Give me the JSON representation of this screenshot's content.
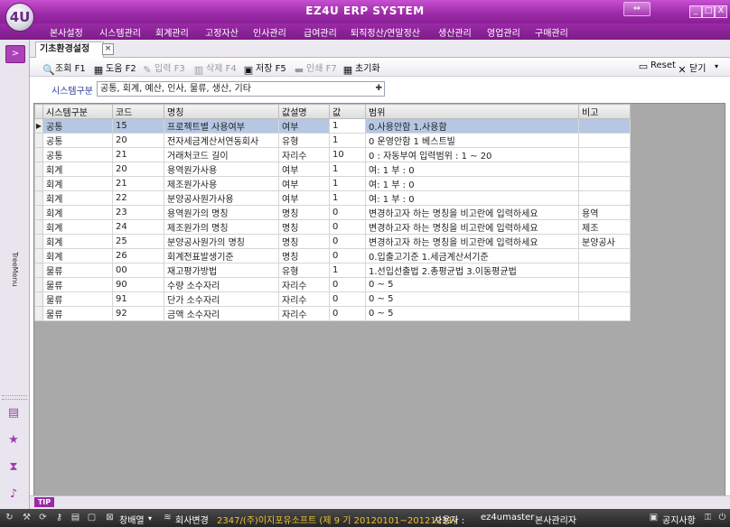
{
  "app": {
    "title": "EZ4U ERP SYSTEM",
    "logo_text": "4U",
    "restore_label": "⇔",
    "minimize_label": "_",
    "maximize_label": "□",
    "close_label": "X"
  },
  "menu": [
    "본사설정",
    "시스템관리",
    "회계관리",
    "고정자산",
    "인사관리",
    "급여관리",
    "퇴직정산/연말정산",
    "생산관리",
    "영업관리",
    "구매관리"
  ],
  "left_panel": {
    "expand_label": ">",
    "tree_label": "TreeMenu"
  },
  "tab": {
    "label": "기초환경설정",
    "close_label": "×"
  },
  "toolbar": {
    "search": "조회 F1",
    "help": "도움 F2",
    "input": "입력 F3",
    "delete": "삭제 F4",
    "save": "저장 F5",
    "print": "인쇄 F7",
    "reset_init": "초기화",
    "reset": "Reset",
    "close": "닫기"
  },
  "filter": {
    "label": "시스템구분",
    "value": "공통, 회계, 예산, 인사, 물류, 생산, 기타"
  },
  "grid": {
    "columns": [
      "시스템구분",
      "코드",
      "명칭",
      "값설명",
      "값",
      "범위",
      "비고"
    ],
    "rows": [
      [
        "공통",
        "15",
        "프로젝트별 사용여부",
        "여부",
        "1",
        "0.사용안함 1.사용함",
        ""
      ],
      [
        "공통",
        "20",
        "전자세금계산서연동회사",
        "유형",
        "1",
        "0 운영안함 1 베스트빌",
        ""
      ],
      [
        "공통",
        "21",
        "거래처코드 길이",
        "자리수",
        "10",
        "0 : 자동부여 입력범위 : 1 ~ 20",
        ""
      ],
      [
        "회계",
        "20",
        "용역원가사용",
        "여부",
        "1",
        "여: 1 부 : 0",
        ""
      ],
      [
        "회계",
        "21",
        "제조원가사용",
        "여부",
        "1",
        "여: 1 부 : 0",
        ""
      ],
      [
        "회계",
        "22",
        "분양공사원가사용",
        "여부",
        "1",
        "여: 1 부 : 0",
        ""
      ],
      [
        "회계",
        "23",
        "용역원가의 명칭",
        "명칭",
        "0",
        "변경하고자 하는 명칭을 비고란에 입력하세요",
        "용역"
      ],
      [
        "회계",
        "24",
        "제조원가의 명칭",
        "명칭",
        "0",
        "변경하고자 하는 명칭을 비고란에 입력하세요",
        "제조"
      ],
      [
        "회계",
        "25",
        "분양공사원가의 명칭",
        "명칭",
        "0",
        "변경하고자 하는 명칭을 비고란에 입력하세요",
        "분양공사"
      ],
      [
        "회계",
        "26",
        "회계전표발생기준",
        "명칭",
        "0",
        "0.입출고기준 1.세금계산서기준",
        ""
      ],
      [
        "물류",
        "00",
        "재고평가방법",
        "유형",
        "1",
        "1.선입선출법 2.총평균법 3.이동평균법",
        ""
      ],
      [
        "물류",
        "90",
        "수량 소수자리",
        "자리수",
        "0",
        "0 ~ 5",
        ""
      ],
      [
        "물류",
        "91",
        "단가 소수자리",
        "자리수",
        "0",
        "0 ~ 5",
        ""
      ],
      [
        "물류",
        "92",
        "금액 소수자리",
        "자리수",
        "0",
        "0 ~ 5",
        ""
      ]
    ],
    "selected_row": 0
  },
  "tip": {
    "label": "TIP"
  },
  "status": {
    "view_mode": "창배열",
    "company_change": "회사변경",
    "company_info": "2347/(주)이지포유소프트 (제 9 기 20120101~20121231)",
    "user_label": "사용자 :",
    "user_id": "ez4umaster",
    "user_name": "본사관리자",
    "notice": "공지사항"
  }
}
